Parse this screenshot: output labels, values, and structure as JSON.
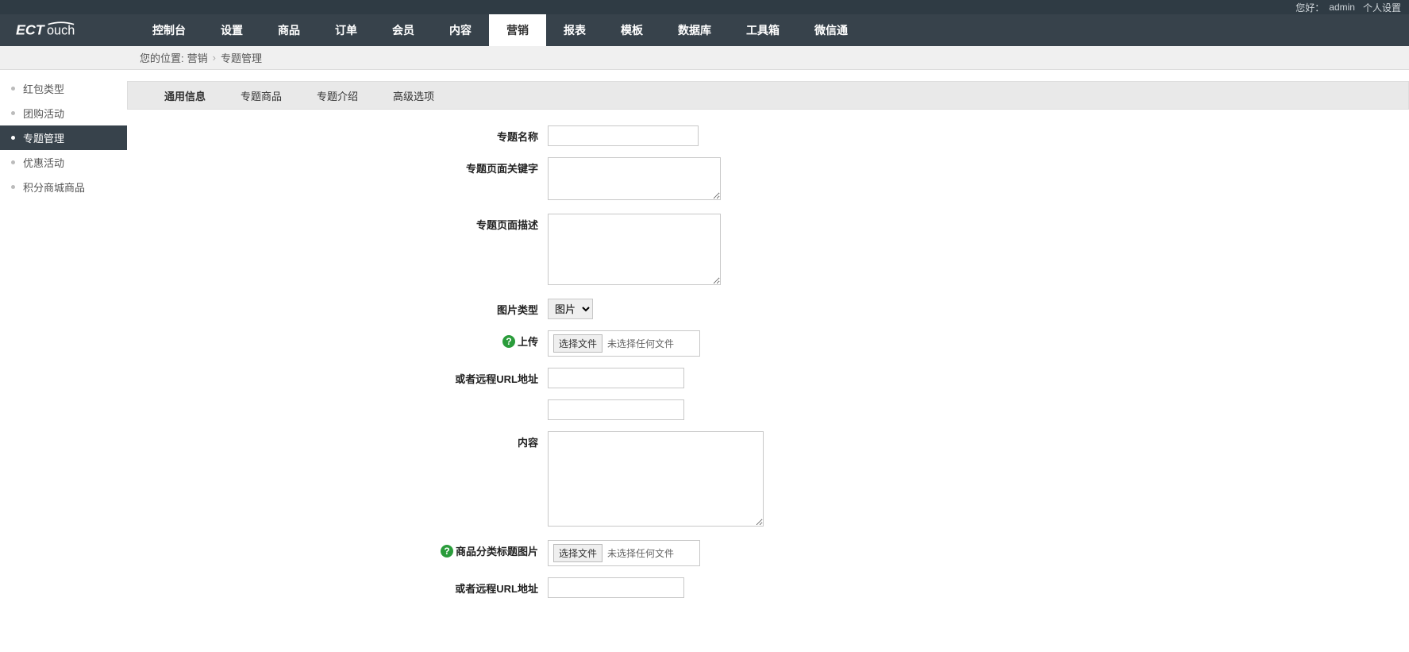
{
  "topbar": {
    "greeting": "您好：",
    "user": "admin",
    "settings": "个人设置"
  },
  "nav": {
    "items": [
      "控制台",
      "设置",
      "商品",
      "订单",
      "会员",
      "内容",
      "营销",
      "报表",
      "模板",
      "数据库",
      "工具箱",
      "微信通"
    ],
    "active_index": 6
  },
  "breadcrumb": {
    "prefix": "您的位置:",
    "segs": [
      "营销",
      "专题管理"
    ]
  },
  "sidebar": {
    "items": [
      "红包类型",
      "团购活动",
      "专题管理",
      "优惠活动",
      "积分商城商品"
    ],
    "active_index": 2
  },
  "tabs": {
    "items": [
      "通用信息",
      "专题商品",
      "专题介绍",
      "高级选项"
    ],
    "active_index": 0
  },
  "form": {
    "name_label": "专题名称",
    "name_value": "",
    "keywords_label": "专题页面关键字",
    "keywords_value": "",
    "desc_label": "专题页面描述",
    "desc_value": "",
    "pic_type_label": "图片类型",
    "pic_type_selected": "图片",
    "upload_label": "上传",
    "file_btn": "选择文件",
    "file_none": "未选择任何文件",
    "remote_url_label": "或者远程URL地址",
    "remote_url_value": "",
    "extra_value": "",
    "content_label": "内容",
    "content_value": "",
    "cat_pic_label": "商品分类标题图片",
    "remote_url2_label": "或者远程URL地址",
    "remote_url2_value": ""
  }
}
